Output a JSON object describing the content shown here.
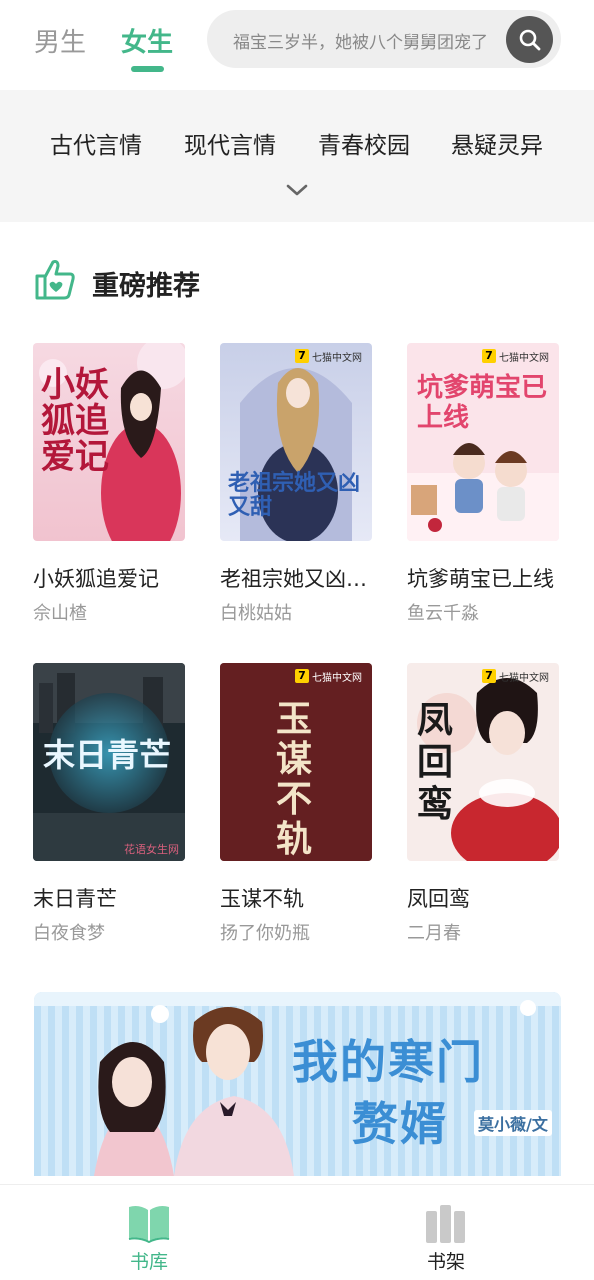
{
  "header": {
    "tabs": [
      {
        "label": "男生",
        "active": false
      },
      {
        "label": "女生",
        "active": true
      }
    ],
    "search": {
      "placeholder": "福宝三岁半，她被八个舅舅团宠了",
      "icon": "search-icon"
    }
  },
  "categories": {
    "items": [
      "古代言情",
      "现代言情",
      "青春校园",
      "悬疑灵异"
    ],
    "expand_icon": "chevron-down-icon"
  },
  "section": {
    "title": "重磅推荐",
    "icon": "thumbs-up-icon"
  },
  "books": [
    {
      "title": "小妖狐追爱记",
      "author": "佘山楂",
      "cover_text": "小妖狐追爱记",
      "badge": ""
    },
    {
      "title": "老祖宗她又凶又甜",
      "author": "白桃姑姑",
      "cover_text": "老祖宗她又凶又甜",
      "badge": "七猫中文网"
    },
    {
      "title": "坑爹萌宝已上线",
      "author": "鱼云千淼",
      "cover_text": "坑爹萌宝已上线",
      "badge": "七猫中文网"
    },
    {
      "title": "末日青芒",
      "author": "白夜食梦",
      "cover_text": "末日青芒",
      "badge": "",
      "watermark": "花语女生网"
    },
    {
      "title": "玉谋不轨",
      "author": "扬了你奶瓶",
      "cover_text": "玉谋不轨",
      "badge": "七猫中文网"
    },
    {
      "title": "凤回鸾",
      "author": "二月春",
      "cover_text": "凤回鸾",
      "badge": "七猫中文网"
    }
  ],
  "banner": {
    "title_line1": "我的寒门",
    "title_line2": "赘婿",
    "author": "莫小薇/文"
  },
  "bottom_nav": {
    "items": [
      {
        "label": "书库",
        "icon": "open-book-icon",
        "active": true
      },
      {
        "label": "书架",
        "icon": "bookshelf-icon",
        "active": false
      }
    ]
  },
  "colors": {
    "accent": "#43b78a",
    "search_bg": "#eeeeee",
    "category_bg": "#f5f5f5"
  }
}
